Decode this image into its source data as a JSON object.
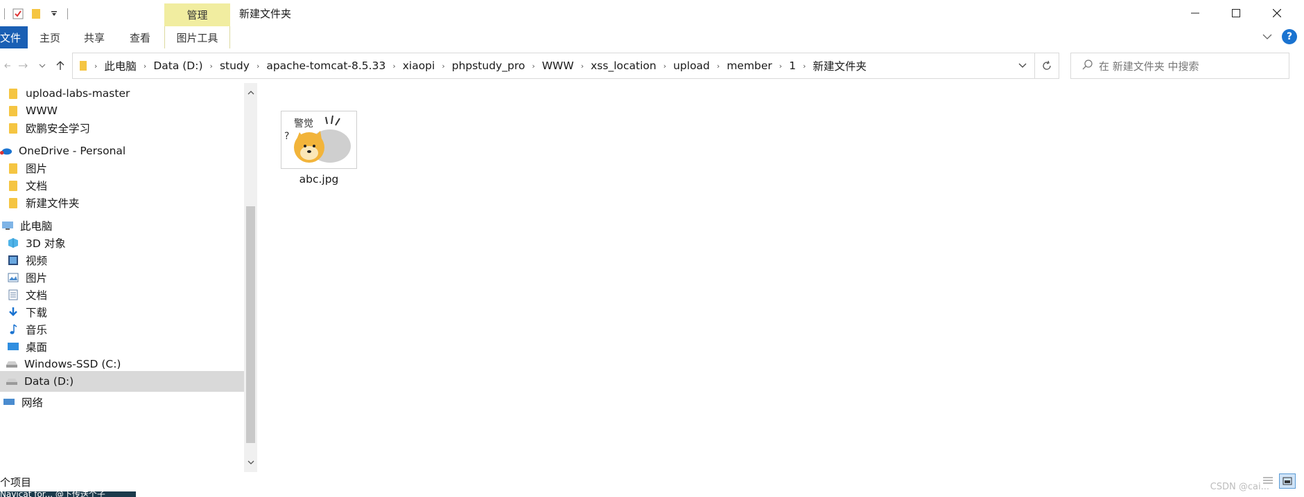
{
  "window": {
    "title": "新建文件夹",
    "context_tab": "管理",
    "controls": [
      "minimize",
      "maximize",
      "close"
    ]
  },
  "ribbon": {
    "tabs": [
      "文件",
      "主页",
      "共享",
      "查看",
      "图片工具"
    ],
    "file_tab_color": "#1a5fb4",
    "context_tab_color": "#f1eda0"
  },
  "address": {
    "breadcrumbs": [
      "此电脑",
      "Data (D:)",
      "study",
      "apache-tomcat-8.5.33",
      "xiaopi",
      "phpstudy_pro",
      "WWW",
      "xss_location",
      "upload",
      "member",
      "1",
      "新建文件夹"
    ]
  },
  "search": {
    "placeholder": "在 新建文件夹 中搜索"
  },
  "nav": {
    "items": [
      {
        "label": "upload-labs-master",
        "icon": "folder-icon"
      },
      {
        "label": "WWW",
        "icon": "folder-icon"
      },
      {
        "label": "欧鹏安全学习",
        "icon": "folder-icon"
      },
      {
        "label": "OneDrive - Personal",
        "icon": "onedrive-icon"
      },
      {
        "label": "图片",
        "icon": "folder-icon"
      },
      {
        "label": "文档",
        "icon": "folder-icon"
      },
      {
        "label": "新建文件夹",
        "icon": "folder-icon"
      },
      {
        "label": "此电脑",
        "icon": "this-pc-icon"
      },
      {
        "label": "3D 对象",
        "icon": "3d-objects-icon"
      },
      {
        "label": "视频",
        "icon": "videos-icon"
      },
      {
        "label": "图片",
        "icon": "pictures-icon"
      },
      {
        "label": "文档",
        "icon": "documents-icon"
      },
      {
        "label": "下载",
        "icon": "downloads-icon"
      },
      {
        "label": "音乐",
        "icon": "music-icon"
      },
      {
        "label": "桌面",
        "icon": "desktop-icon"
      },
      {
        "label": "Windows-SSD (C:)",
        "icon": "drive-icon"
      },
      {
        "label": "Data (D:)",
        "icon": "drive-icon",
        "selected": true
      },
      {
        "label": "网络",
        "icon": "network-icon"
      }
    ]
  },
  "content": {
    "files": [
      {
        "name": "abc.jpg",
        "thumb_text": "警觉",
        "thumb_mark": "?"
      }
    ]
  },
  "status": {
    "count": "个项目",
    "watermark": "CSDN @cai...",
    "taskbar_text": "Navicat for...  @下传送个子"
  }
}
